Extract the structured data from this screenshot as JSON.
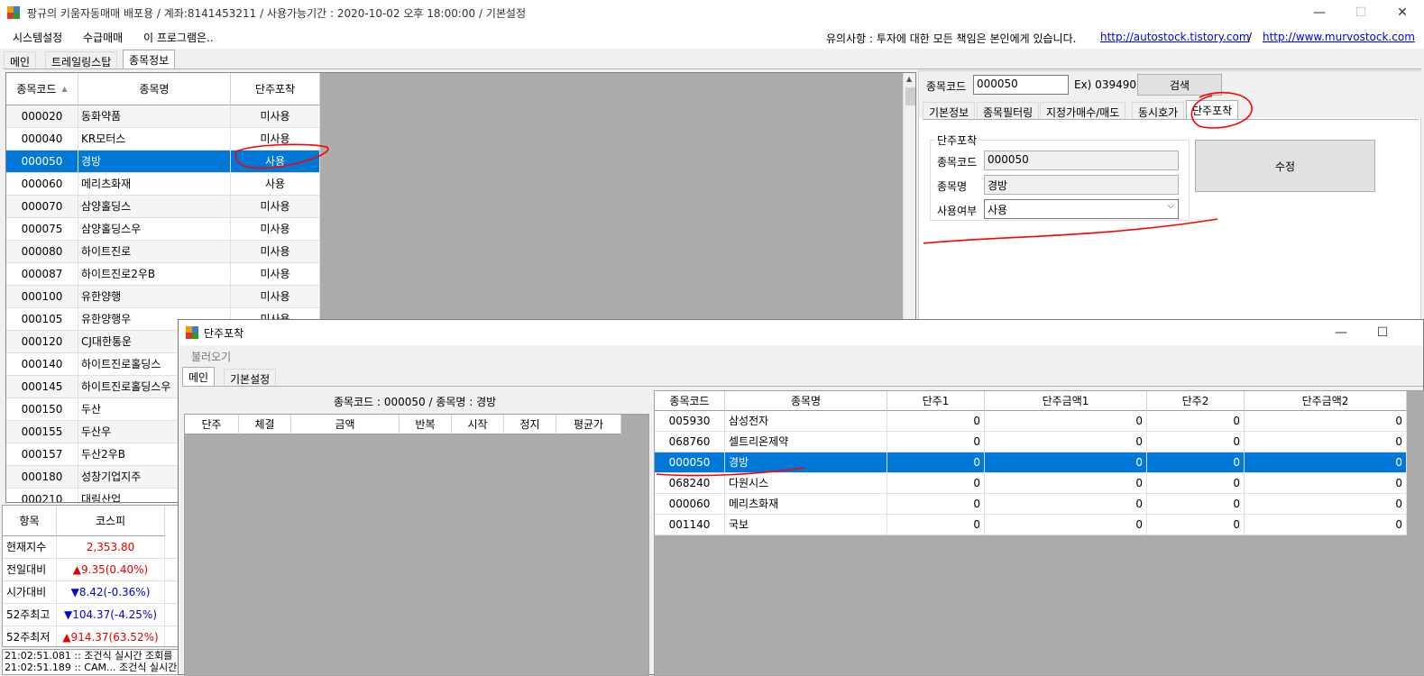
{
  "window": {
    "title": "팡규의 키움자동매매 배포용 / 계좌:8141453211 / 사용가능기간 : 2020-10-02 오후 18:00:00 / 기본설정",
    "minimize": "—",
    "maximize": "☐",
    "close": "✕"
  },
  "menu": {
    "items": [
      "시스템설정",
      "수급매매",
      "이 프로그램은.."
    ],
    "notice": "유의사항 : 투자에 대한 모든 책임은 본인에게 있습니다.",
    "link1": "http://autostock.tistory.com",
    "separator": "/",
    "link2": "http://www.murvostock.com"
  },
  "main_tabs": [
    "메인",
    "트레일링스탑",
    "종목정보"
  ],
  "stock_list": {
    "headers": [
      "종목코드",
      "종목명",
      "단주포착"
    ],
    "sort_icon": "▲",
    "rows": [
      [
        "000020",
        "동화약품",
        "미사용"
      ],
      [
        "000040",
        "KR모터스",
        "미사용"
      ],
      [
        "000050",
        "경방",
        "사용"
      ],
      [
        "000060",
        "메리츠화재",
        "사용"
      ],
      [
        "000070",
        "삼양홀딩스",
        "미사용"
      ],
      [
        "000075",
        "삼양홀딩스우",
        "미사용"
      ],
      [
        "000080",
        "하이트진로",
        "미사용"
      ],
      [
        "000087",
        "하이트진로2우B",
        "미사용"
      ],
      [
        "000100",
        "유한양행",
        "미사용"
      ],
      [
        "000105",
        "유한양행우",
        "미사용"
      ],
      [
        "000120",
        "CJ대한통운",
        ""
      ],
      [
        "000140",
        "하이트진로홀딩스",
        ""
      ],
      [
        "000145",
        "하이트진로홀딩스우",
        ""
      ],
      [
        "000150",
        "두산",
        ""
      ],
      [
        "000155",
        "두산우",
        ""
      ],
      [
        "000157",
        "두산2우B",
        ""
      ],
      [
        "000180",
        "성창기업지주",
        ""
      ],
      [
        "000210",
        "대림산업",
        ""
      ]
    ],
    "selected_index": 2
  },
  "index_table": {
    "headers": [
      "항목",
      "코스피"
    ],
    "rows": [
      {
        "label": "현재지수",
        "value": "2,353.80",
        "color": "#e00000"
      },
      {
        "label": "전일대비",
        "value": "▲9.35(0.40%)",
        "color": "#e00000"
      },
      {
        "label": "시가대비",
        "value": "▼8.42(-0.36%)",
        "color": "#0000e0"
      },
      {
        "label": "52주최고",
        "value": "▼104.37(-4.25%)",
        "color": "#0000e0"
      },
      {
        "label": "52주최저",
        "value": "▲914.37(63.52%)",
        "color": "#e00000"
      }
    ]
  },
  "log": [
    "21:02:51.081 :: 조건식 실시간 조회를",
    "21:02:51.189 :: CAM... 조건식 실시간"
  ],
  "right_panel": {
    "code_label": "종목코드",
    "code_value": "000050",
    "example": "Ex) 039490",
    "search_button": "검색",
    "tabs": [
      "기본정보",
      "종목필터링",
      "지정가매수/매도",
      "동시호가",
      "단주포착"
    ],
    "group_title": "단주포착",
    "field_code_label": "종목코드",
    "field_code_value": "000050",
    "field_name_label": "종목명",
    "field_name_value": "경방",
    "field_use_label": "사용여부",
    "field_use_value": "사용",
    "edit_button": "수정"
  },
  "dialog": {
    "title": "단주포착",
    "menu": "불러오기",
    "tabs": [
      "메인",
      "기본설정"
    ],
    "info": "종목코드 : 000050 / 종목명 : 경방",
    "left_headers": [
      "단주",
      "체결",
      "금액",
      "반복",
      "시작",
      "정지",
      "평균가"
    ],
    "right_headers": [
      "종목코드",
      "종목명",
      "단주1",
      "단주금액1",
      "단주2",
      "단주금액2"
    ],
    "rows": [
      [
        "005930",
        "삼성전자",
        "0",
        "0",
        "0",
        "0"
      ],
      [
        "068760",
        "셀트리온제약",
        "0",
        "0",
        "0",
        "0"
      ],
      [
        "000050",
        "경방",
        "0",
        "0",
        "0",
        "0"
      ],
      [
        "068240",
        "다원시스",
        "0",
        "0",
        "0",
        "0"
      ],
      [
        "000060",
        "메리츠화재",
        "0",
        "0",
        "0",
        "0"
      ],
      [
        "001140",
        "국보",
        "0",
        "0",
        "0",
        "0"
      ]
    ],
    "selected_index": 2
  }
}
